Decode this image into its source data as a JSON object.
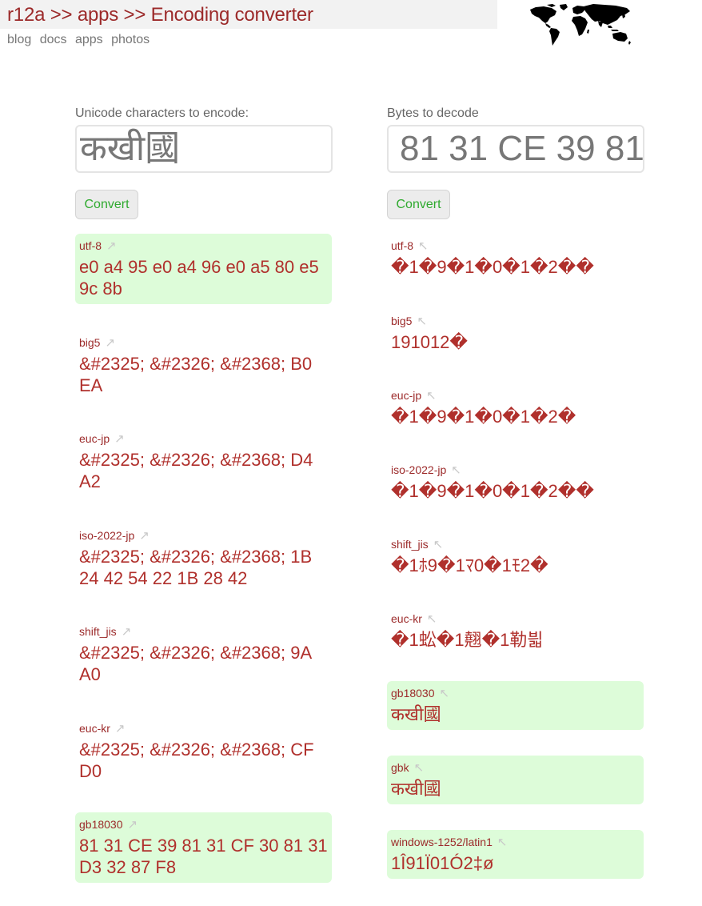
{
  "header": {
    "crumb_home": "r12a",
    "crumb_sep": ">>",
    "crumb_apps": "apps",
    "crumb_current": "Encoding converter",
    "nav": [
      "blog",
      "docs",
      "apps",
      "photos"
    ]
  },
  "encode": {
    "label": "Unicode characters to encode:",
    "input_value": "कखी國",
    "button": "Convert",
    "results": [
      {
        "name": "utf-8",
        "arrow": "↗",
        "value": "e0 a4 95 e0 a4 96 e0 a5 80 e5 9c 8b",
        "match": true
      },
      {
        "name": "big5",
        "arrow": "↗",
        "value": "&#2325; &#2326; &#2368; B0 EA",
        "match": false
      },
      {
        "name": "euc-jp",
        "arrow": "↗",
        "value": "&#2325; &#2326; &#2368; D4 A2",
        "match": false
      },
      {
        "name": "iso-2022-jp",
        "arrow": "↗",
        "value": "&#2325; &#2326; &#2368; 1B 24 42 54 22 1B 28 42",
        "match": false
      },
      {
        "name": "shift_jis",
        "arrow": "↗",
        "value": "&#2325; &#2326; &#2368; 9A A0",
        "match": false
      },
      {
        "name": "euc-kr",
        "arrow": "↗",
        "value": "&#2325; &#2326; &#2368; CF D0",
        "match": false
      },
      {
        "name": "gb18030",
        "arrow": "↗",
        "value": "81 31 CE 39 81 31 CF 30 81 31 D3 32 87 F8",
        "match": true
      }
    ]
  },
  "decode": {
    "label": "Bytes to decode",
    "input_value": "81 31 CE 39 81 31 CF 30 81 31 D3 32 87 F8",
    "button": "Convert",
    "results": [
      {
        "name": "utf-8",
        "arrow": "↖",
        "value": "�1�9�1�0�1�2��",
        "match": false
      },
      {
        "name": "big5",
        "arrow": "↖",
        "value": "191012�",
        "match": false
      },
      {
        "name": "euc-jp",
        "arrow": "↖",
        "value": "�1�9�1�0�1�2�",
        "match": false
      },
      {
        "name": "iso-2022-jp",
        "arrow": "↖",
        "value": "�1�9�1�0�1�2��",
        "match": false
      },
      {
        "name": "shift_jis",
        "arrow": "↖",
        "value": "�1ﾎ9�1ﾏ0�1ﾓ2�",
        "match": false
      },
      {
        "name": "euc-kr",
        "arrow": "↖",
        "value": "�1蚣�1翹�1勒븳",
        "match": false
      },
      {
        "name": "gb18030",
        "arrow": "↖",
        "value": "कखी國",
        "match": true
      },
      {
        "name": "gbk",
        "arrow": "↖",
        "value": "कखी國",
        "match": true
      },
      {
        "name": "windows-1252/latin1",
        "arrow": "↖",
        "value": "1Î91Ï01Ó2‡ø",
        "match": true
      }
    ]
  },
  "colors": {
    "accent": "#9c2a2a",
    "match_bg": "#ddfcd9",
    "button_text": "#2eaa2e"
  },
  "icons": {
    "logo": "world-map-icon",
    "encode_arrow": "arrow-up-right-icon",
    "decode_arrow": "arrow-up-left-icon"
  }
}
